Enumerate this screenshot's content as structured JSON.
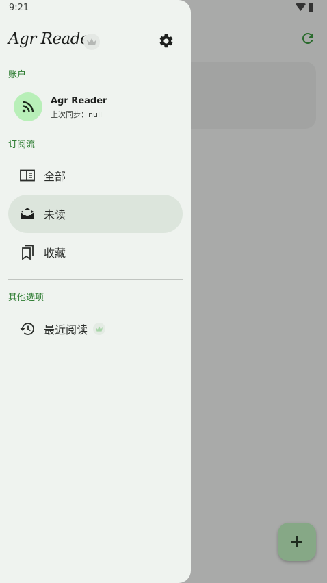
{
  "status_bar": {
    "time": "9:21"
  },
  "drawer": {
    "title": "Agr Reader",
    "settings_icon": "gear-icon",
    "account_section": {
      "label": "账户",
      "account": {
        "name": "Agr Reader",
        "sync_text": "上次同步：null",
        "icon": "rss-icon"
      }
    },
    "feeds_section": {
      "label": "订阅流",
      "items": [
        {
          "label": "全部",
          "icon": "article-icon",
          "active": false
        },
        {
          "label": "未读",
          "icon": "open-mail-icon",
          "active": true
        },
        {
          "label": "收藏",
          "icon": "bookmarks-icon",
          "active": false
        }
      ]
    },
    "other_section": {
      "label": "其他选项",
      "items": [
        {
          "label": "最近阅读",
          "icon": "history-icon",
          "premium": true
        }
      ]
    }
  },
  "background": {
    "refresh_icon": "refresh-icon",
    "fab_icon": "plus-icon"
  },
  "colors": {
    "accent": "#2e7d32",
    "drawer_bg": "#eff3ef",
    "active_item_bg": "#dce5dc",
    "avatar_bg": "#b8efb8",
    "scrim": "#a9aaa9",
    "fab_bg": "#86a886"
  }
}
